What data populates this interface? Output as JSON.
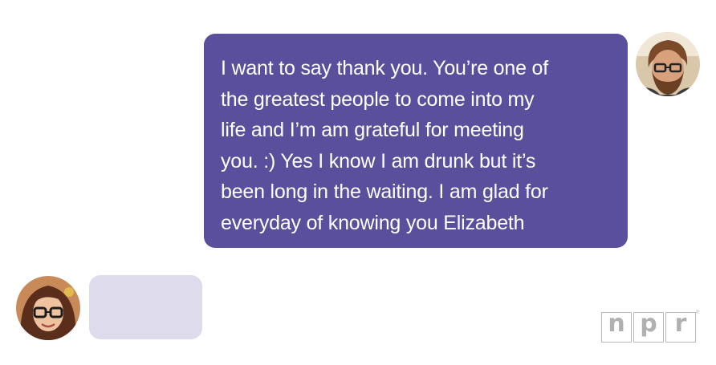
{
  "conversation": {
    "sent_message": {
      "lines": [
        "I want to say thank you. You’re one of",
        "the greatest people to come into my",
        "life and I’m am grateful for meeting",
        "you. :) Yes I know I am drunk but it’s",
        "been long in the waiting. I am glad for",
        "everyday of knowing you Elizabeth"
      ]
    },
    "typing_bubble": {
      "text": ""
    }
  },
  "branding": {
    "logo_letters": [
      "n",
      "p",
      "r"
    ],
    "logo_mark": "®"
  },
  "colors": {
    "sent_bubble": "#5a4f9c",
    "typing_bubble": "#dedcec",
    "logo_gray": "#b0b0b0"
  },
  "icons": {
    "sender_avatar": "bearded-man-avatar-icon",
    "recipient_avatar": "woman-with-glasses-avatar-icon"
  }
}
